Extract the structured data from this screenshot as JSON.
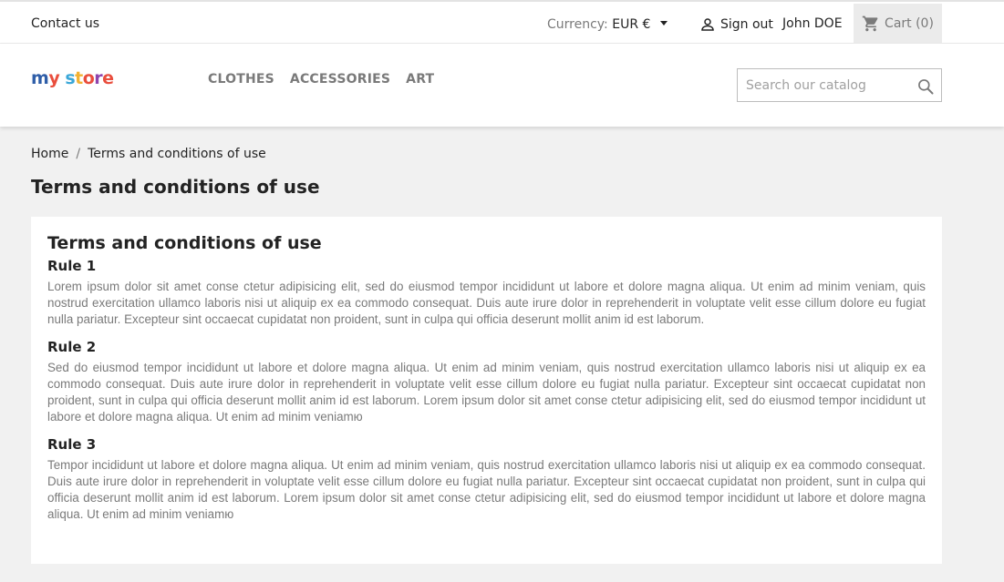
{
  "topbar": {
    "contact": "Contact us",
    "currency_label": "Currency:",
    "currency_value": "EUR €",
    "signout": "Sign out",
    "username": "John DOE",
    "cart": "Cart (0)"
  },
  "header": {
    "logo": {
      "my": "my",
      "store": "store"
    },
    "menu": [
      "CLOTHES",
      "ACCESSORIES",
      "ART"
    ],
    "search_placeholder": "Search our catalog"
  },
  "breadcrumb": [
    "Home",
    "Terms and conditions of use"
  ],
  "page_title": "Terms and conditions of use",
  "content": {
    "heading": "Terms and conditions of use",
    "rules": [
      {
        "title": "Rule 1",
        "text": "Lorem ipsum dolor sit amet conse ctetur adipisicing elit, sed do eiusmod tempor incididunt ut labore et dolore magna aliqua. Ut enim ad minim veniam, quis nostrud exercitation ullamco laboris nisi ut aliquip ex ea commodo consequat. Duis aute irure dolor in reprehenderit in voluptate velit esse cillum dolore eu fugiat nulla pariatur. Excepteur sint occaecat cupidatat non proident, sunt in culpa qui officia deserunt mollit anim id est laborum."
      },
      {
        "title": "Rule 2",
        "text": "Sed do eiusmod tempor incididunt ut labore et dolore magna aliqua. Ut enim ad minim veniam, quis nostrud exercitation ullamco laboris nisi ut aliquip ex ea commodo consequat. Duis aute irure dolor in reprehenderit in voluptate velit esse cillum dolore eu fugiat nulla pariatur. Excepteur sint occaecat cupidatat non proident, sunt in culpa qui officia deserunt mollit anim id est laborum. Lorem ipsum dolor sit amet conse ctetur adipisicing elit, sed do eiusmod tempor incididunt ut labore et dolore magna aliqua. Ut enim ad minim veniamю"
      },
      {
        "title": "Rule 3",
        "text": "Tempor incididunt ut labore et dolore magna aliqua. Ut enim ad minim veniam, quis nostrud exercitation ullamco laboris nisi ut aliquip ex ea commodo consequat. Duis aute irure dolor in reprehenderit in voluptate velit esse cillum dolore eu fugiat nulla pariatur. Excepteur sint occaecat cupidatat non proident, sunt in culpa qui officia deserunt mollit anim id est laborum. Lorem ipsum dolor sit amet conse ctetur adipisicing elit, sed do eiusmod tempor incididunt ut labore et dolore magna aliqua. Ut enim ad minim veniamю"
      }
    ]
  },
  "icons": {
    "user": "user-icon",
    "cart": "shopping-cart-icon",
    "search": "search-icon",
    "currency_caret": "caret-down-icon"
  },
  "colors": {
    "page_background": "#f1f1f1",
    "text_primary": "#232323",
    "text_muted": "#7a7a7a",
    "cart_background": "#ebebeb"
  }
}
